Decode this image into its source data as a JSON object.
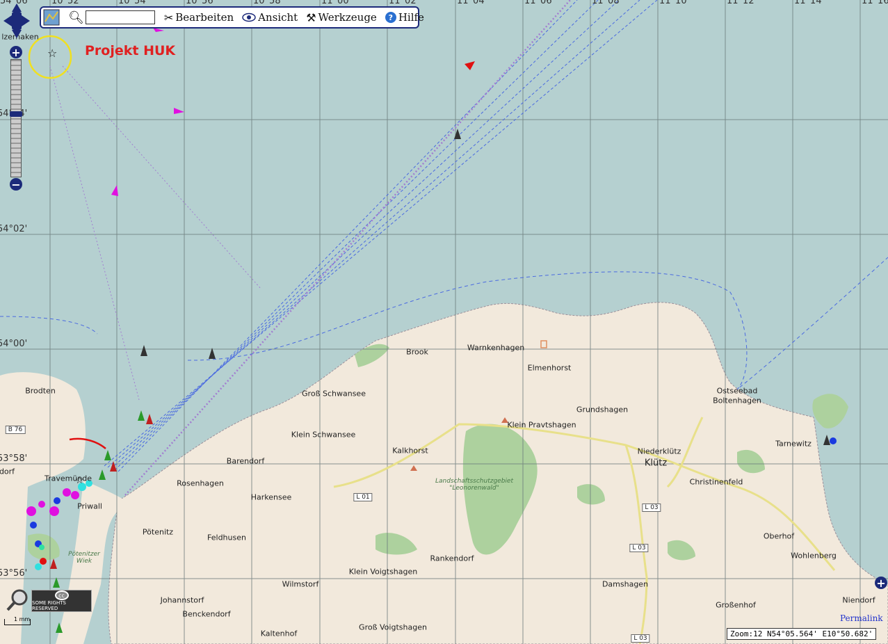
{
  "toolbar": {
    "edit_label": "Bearbeiten",
    "view_label": "Ansicht",
    "tools_label": "Werkzeuge",
    "help_label": "Hilfe",
    "search_value": ""
  },
  "project_label": "Projekt HUK",
  "status_bar": "Zoom:12 N54°05.564' E10°50.682'",
  "permalink": "Permalink",
  "cc_badge": {
    "line1": "SOME RIGHTS RESERVED",
    "symbol": "cc"
  },
  "scale_label": "1 mm",
  "grid_labels": {
    "top": [
      "54°06'",
      "10°52'",
      "10°54'",
      "10°56'",
      "10°58'",
      "11°00'",
      "11°02'",
      "11°04'",
      "11°06'",
      "11°08'",
      "11°10'",
      "11°12'",
      "11°14'",
      "11°16'"
    ],
    "left": [
      "54°04'",
      "54°02'",
      "54°00'",
      "53°58'",
      "53°56'"
    ]
  },
  "places": [
    {
      "name": "Brook"
    },
    {
      "name": "Warnkenhagen"
    },
    {
      "name": "Elmenhorst"
    },
    {
      "name": "Groß Schwansee"
    },
    {
      "name": "Klein Pravtshagen"
    },
    {
      "name": "Grundshagen"
    },
    {
      "name": "Ostseebad"
    },
    {
      "name": "Boltenhagen"
    },
    {
      "name": "Klein Schwansee"
    },
    {
      "name": "Tarnewitz"
    },
    {
      "name": "Kalkhorst"
    },
    {
      "name": "Niederklütz"
    },
    {
      "name": "Klütz"
    },
    {
      "name": "Christinenfeld"
    },
    {
      "name": "Barendorf"
    },
    {
      "name": "Rosenhagen"
    },
    {
      "name": "Harkensee"
    },
    {
      "name": "Brodten"
    },
    {
      "name": "Travemünde"
    },
    {
      "name": "Priwall"
    },
    {
      "name": "Pötenitz"
    },
    {
      "name": "Feldhusen"
    },
    {
      "name": "Oberhof"
    },
    {
      "name": "Wohlenberg"
    },
    {
      "name": "Rankendorf"
    },
    {
      "name": "Klein Voigtshagen"
    },
    {
      "name": "Wilmstorf"
    },
    {
      "name": "Damshagen"
    },
    {
      "name": "Johannstorf"
    },
    {
      "name": "Benckendorf"
    },
    {
      "name": "Niendorf"
    },
    {
      "name": "Großenhof"
    },
    {
      "name": "Groß Voigtshagen"
    },
    {
      "name": "Kaltenhof"
    },
    {
      "name": "Pötenitzer Wiek"
    },
    {
      "name": "Landschaftsschutzgebiet \"Leonorenwald\""
    },
    {
      "name": "lzerhaken"
    },
    {
      "name": "dorf"
    }
  ],
  "roads": [
    "B 76",
    "L 01",
    "L 03",
    "L 03",
    "L 03"
  ],
  "colors": {
    "sea": "#b5d0d0",
    "land": "#f2e9dc",
    "forest": "#add19e",
    "accent": "#1c2a7a",
    "project": "#e02020"
  }
}
